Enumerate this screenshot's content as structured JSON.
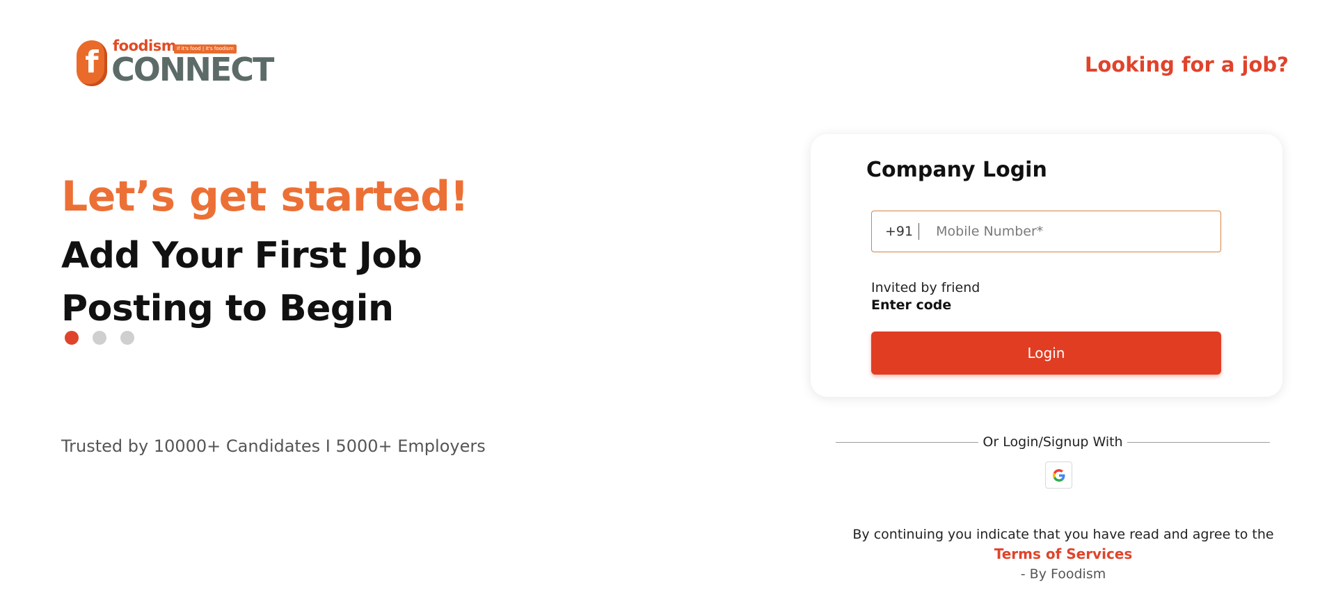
{
  "header": {
    "logo_top": "foodism",
    "logo_tag": "if it's food | it's foodism",
    "logo_main": "CONNECT",
    "logo_badge_letter": "f",
    "job_link": "Looking for a job?"
  },
  "hero": {
    "title": "Let’s get started!",
    "subtitle_line1": "Add Your First Job",
    "subtitle_line2": "Posting to Begin",
    "carousel": {
      "total": 3,
      "active": 1
    },
    "trusted": "Trusted by 10000+ Candidates I 5000+ Employers"
  },
  "login": {
    "title": "Company Login",
    "country_code": "+91",
    "mobile_placeholder": "Mobile Number*",
    "mobile_value": "",
    "invited_label": "Invited by friend",
    "enter_code": "Enter code",
    "button": "Login"
  },
  "social": {
    "divider_text": "Or Login/Signup With",
    "provider_icon": "google-icon"
  },
  "footer": {
    "consent": "By continuing you indicate that you have read and agree to the",
    "terms_link": "Terms of Services",
    "by_line": "- By Foodism"
  },
  "colors": {
    "brand_red": "#e0432b",
    "brand_orange": "#ec7035",
    "logo_gray": "#5c6b67"
  }
}
